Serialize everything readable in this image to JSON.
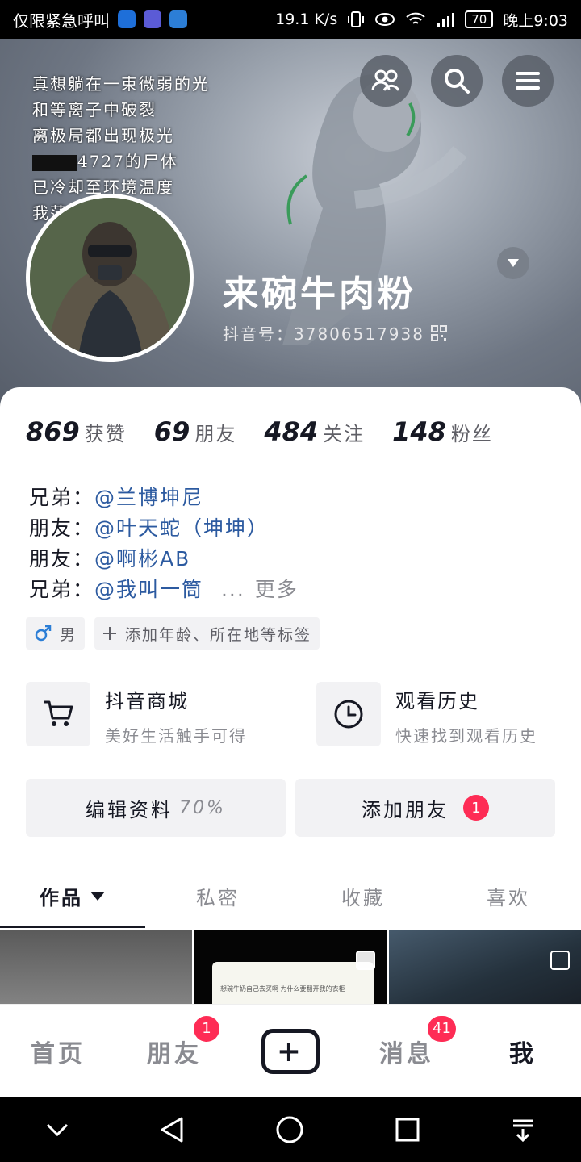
{
  "statusbar": {
    "carrier": "仅限紧急呼叫",
    "speed": "19.1 K/s",
    "battery": "70",
    "time": "晚上9:03"
  },
  "header": {
    "poem": [
      "真想躺在一束微弱的光",
      "和等离子中破裂",
      "离极局都出现极光",
      "4727的尸体",
      "已冷却至环境温度",
      "我茫"
    ],
    "nickname": "来碗牛肉粉",
    "douyin_id": "抖音号：37806517938"
  },
  "stats": [
    {
      "value": "869",
      "label": "获赞"
    },
    {
      "value": "69",
      "label": "朋友"
    },
    {
      "value": "484",
      "label": "关注"
    },
    {
      "value": "148",
      "label": "粉丝"
    }
  ],
  "bio": [
    {
      "prefix": "兄弟：",
      "mention": "@兰博坤尼",
      "suffix": ""
    },
    {
      "prefix": "朋友：",
      "mention": "@叶天蛇（坤坤）",
      "suffix": ""
    },
    {
      "prefix": "朋友：",
      "mention": "@啊彬AB",
      "suffix": ""
    },
    {
      "prefix": "兄弟：",
      "mention": "@我叫一筒",
      "suffix": "..."
    }
  ],
  "bio_more": "更多",
  "tags": {
    "gender": "男",
    "add": "添加年龄、所在地等标签"
  },
  "quick": {
    "shop_title": "抖音商城",
    "shop_sub": "美好生活触手可得",
    "history_title": "观看历史",
    "history_sub": "快速找到观看历史"
  },
  "actions": {
    "edit": "编辑资料",
    "edit_pct": "70%",
    "add_friend": "添加朋友",
    "add_friend_badge": "1"
  },
  "tabs": [
    "作品",
    "私密",
    "收藏",
    "喜欢"
  ],
  "grid": {
    "chat_text": "想碗牛奶自己去买啊 为什么要翻开我的衣柜"
  },
  "bottomnav": {
    "home": "首页",
    "friends": "朋友",
    "friends_badge": "1",
    "messages": "消息",
    "messages_badge": "41",
    "me": "我"
  }
}
